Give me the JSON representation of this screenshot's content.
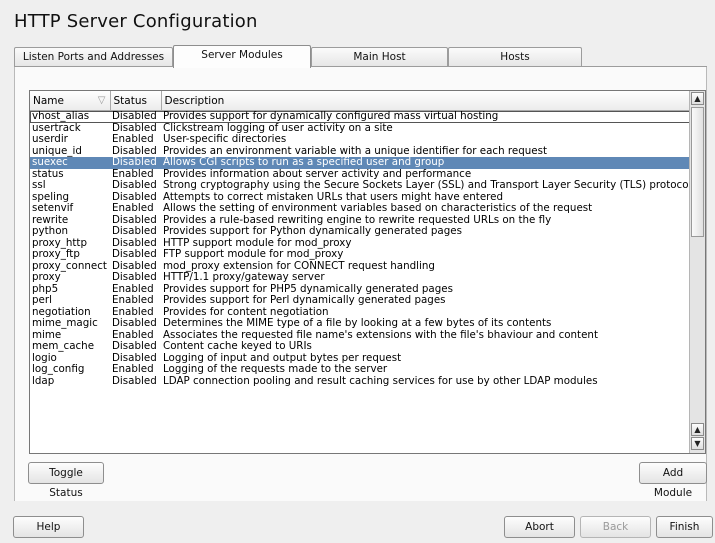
{
  "window": {
    "title": "HTTP Server Configuration"
  },
  "tabs": [
    {
      "label": "Listen Ports and Addresses",
      "active": false
    },
    {
      "label": "Server Modules",
      "active": true
    },
    {
      "label": "Main Host",
      "active": false
    },
    {
      "label": "Hosts",
      "active": false
    }
  ],
  "table": {
    "columns": [
      "Name",
      "Status",
      "Description"
    ],
    "selected_row": 5,
    "focused_row": 0,
    "rows": [
      [
        "vhost_alias",
        "Disabled",
        "Provides support for dynamically configured mass virtual hosting"
      ],
      [
        "usertrack",
        "Disabled",
        "Clickstream logging of user activity on a site"
      ],
      [
        "userdir",
        "Enabled",
        "User-specific directories"
      ],
      [
        "unique_id",
        "Disabled",
        "Provides an environment variable with a unique identifier for each request"
      ],
      [
        "suexec",
        "Disabled",
        "Allows CGI scripts to run as a specified user and group"
      ],
      [
        "status",
        "Enabled",
        "Provides information about server activity and performance"
      ],
      [
        "ssl",
        "Disabled",
        "Strong cryptography using the Secure Sockets Layer (SSL) and Transport Layer Security (TLS) protocols"
      ],
      [
        "speling",
        "Disabled",
        "Attempts to correct mistaken URLs that users might have entered"
      ],
      [
        "setenvif",
        "Enabled",
        "Allows the setting of environment variables based on characteristics of the request"
      ],
      [
        "rewrite",
        "Disabled",
        "Provides a rule-based rewriting engine to rewrite requested URLs on the fly"
      ],
      [
        "python",
        "Disabled",
        "Provides support for Python dynamically generated pages"
      ],
      [
        "proxy_http",
        "Disabled",
        "HTTP support module for mod_proxy"
      ],
      [
        "proxy_ftp",
        "Disabled",
        "FTP support module for mod_proxy"
      ],
      [
        "proxy_connect",
        "Disabled",
        "mod_proxy extension for CONNECT request handling"
      ],
      [
        "proxy",
        "Disabled",
        "HTTP/1.1 proxy/gateway server"
      ],
      [
        "php5",
        "Enabled",
        "Provides support for PHP5 dynamically generated pages"
      ],
      [
        "perl",
        "Enabled",
        "Provides support for Perl dynamically generated pages"
      ],
      [
        "negotiation",
        "Enabled",
        "Provides for content negotiation"
      ],
      [
        "mime_magic",
        "Disabled",
        "Determines the MIME type of a file by looking at a few bytes of its contents"
      ],
      [
        "mime",
        "Enabled",
        "Associates the requested file name's extensions with the file's bhaviour and content"
      ],
      [
        "mem_cache",
        "Disabled",
        "Content cache keyed to URIs"
      ],
      [
        "logio",
        "Disabled",
        "Logging of input and output bytes per request"
      ],
      [
        "log_config",
        "Enabled",
        "Logging of the requests made to the server"
      ],
      [
        "ldap",
        "Disabled",
        "LDAP connection pooling and result caching services for use by other LDAP modules"
      ]
    ]
  },
  "buttons": {
    "toggle_status": "Toggle Status",
    "add_module": "Add Module",
    "help": "Help",
    "abort": "Abort",
    "back": "Back",
    "finish": "Finish"
  },
  "icons": {
    "sort": "sort-triangle-icon",
    "scroll_up": "arrow-up-icon",
    "scroll_down": "arrow-down-icon"
  }
}
